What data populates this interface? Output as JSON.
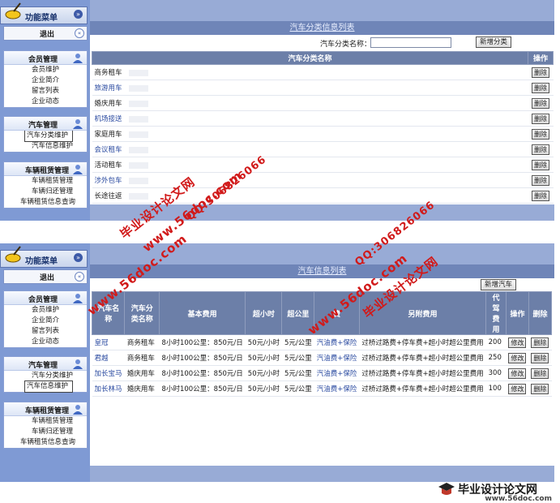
{
  "sidebar": {
    "menu_title": "功能菜单",
    "logout": "退出",
    "groups": [
      {
        "title": "会员管理",
        "items": [
          "会员维护",
          "企业简介",
          "留言列表",
          "企业动态"
        ]
      },
      {
        "title": "汽车管理",
        "items": [
          "汽车分类维护",
          "汽车信息维护"
        ]
      },
      {
        "title": "车辆租赁管理",
        "items": [
          "车辆租赁管理",
          "车辆归还管理",
          "车辆租赁信息查询"
        ]
      }
    ]
  },
  "screen1": {
    "title": "汽车分类信息列表",
    "search_label": "汽车分类名称：",
    "search_value": "",
    "add_button": "新增分类",
    "headers": [
      "汽车分类名称",
      "操作"
    ],
    "rows": [
      "商务租车",
      "旅游用车",
      "婚庆用车",
      "机场接送",
      "家庭用车",
      "会议租车",
      "活动租车",
      "涉外包车",
      "长途往返"
    ],
    "delete_label": "删除"
  },
  "screen2": {
    "title": "汽车信息列表",
    "add_button": "新增汽车",
    "headers": [
      "汽车名称",
      "汽车分类名称",
      "基本费用",
      "超小时",
      "超公里",
      "费",
      "另附费用",
      "代驾费用",
      "操作",
      "删除"
    ],
    "rows": [
      [
        "皇冠",
        "商务租车",
        "8小时100公里：850元/日",
        "50元/小时",
        "5元/公里",
        "汽油费+保险",
        "过桥过路费+停车费+超小时超公里费用",
        "200"
      ],
      [
        "君越",
        "商务租车",
        "8小时100公里：850元/日",
        "50元/小时",
        "5元/公里",
        "汽油费+保险",
        "过桥过路费+停车费+超小时超公里费用",
        "250"
      ],
      [
        "加长宝马",
        "婚庆用车",
        "8小时100公里：850元/日",
        "50元/小时",
        "5元/公里",
        "汽油费+保险",
        "过桥过路费+停车费+超小时超公里费用",
        "300"
      ],
      [
        "加长林马",
        "婚庆用车",
        "8小时100公里：850元/日",
        "50元/小时",
        "5元/公里",
        "汽油费+保险",
        "过桥过路费+停车费+超小时超公里费用",
        "100"
      ]
    ],
    "edit_label": "修改",
    "delete_label": "删除"
  },
  "watermarks": {
    "site": "毕业设计论文网",
    "url": "www.56doc.com",
    "qq": "QQ:306826066",
    "footer_title": "毕业设计论文网",
    "footer_url": "www.56doc.com"
  },
  "colors": {
    "sidebar": "#7f9ad4",
    "header_bar": "#6f85b8",
    "table_header": "#6c7fa8",
    "watermark": "#d11a1a"
  }
}
